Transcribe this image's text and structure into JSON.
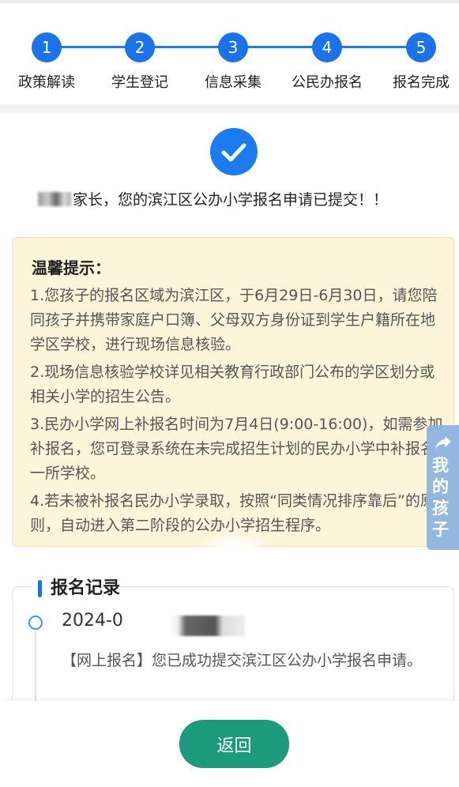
{
  "steps": [
    {
      "number": "1",
      "label": "政策解读"
    },
    {
      "number": "2",
      "label": "学生登记"
    },
    {
      "number": "3",
      "label": "信息采集"
    },
    {
      "number": "4",
      "label": "公民办报名"
    },
    {
      "number": "5",
      "label": "报名完成"
    }
  ],
  "status": {
    "icon": "check-circle-icon",
    "message": "家长，您的滨江区公办小学报名申请已提交！！"
  },
  "tips": {
    "title": "温馨提示：",
    "items": [
      "1.您孩子的报名区域为滨江区，于6月29日-6月30日，请您陪同孩子并携带家庭户口簿、父母双方身份证到学生户籍所在地学区学校，进行现场信息核验。",
      "2.现场信息核验学校详见相关教育行政部门公布的学区划分或相关小学的招生公告。",
      "3.民办小学网上补报名时间为7月4日(9:00-16:00)，如需参加补报名，您可登录系统在未完成招生计划的民办小学中补报名一所学校。",
      "4.若未被补报名民办小学录取，按照“同类情况排序靠后”的原则，自动进入第二阶段的公办小学招生程序。"
    ]
  },
  "records": {
    "title": "报名记录",
    "entries": [
      {
        "date": "2024-0",
        "desc": "【网上报名】您已成功提交滨江区公办小学报名申请。"
      }
    ]
  },
  "side_tab": {
    "icon": "share-arrow-icon",
    "label": "我的孩子"
  },
  "footer": {
    "back_label": "返回"
  },
  "colors": {
    "accent": "#1a73e8",
    "button": "#1b9a7c",
    "tips_bg": "#fdf5d9"
  }
}
